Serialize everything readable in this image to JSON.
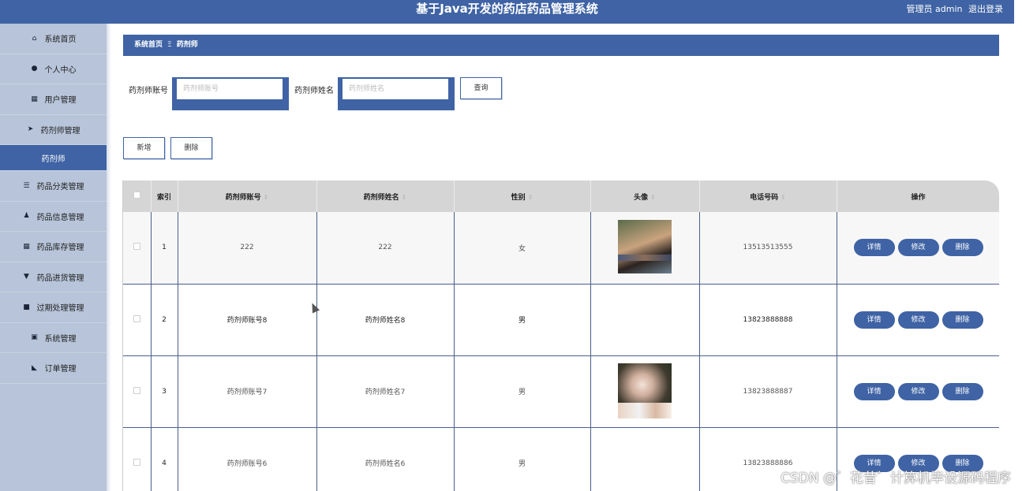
{
  "app": {
    "title": "基于Java开发的药店药品管理系统",
    "user_label": "管理员 admin",
    "logout_label": "退出登录"
  },
  "sidebar": {
    "items": [
      {
        "label": "系统首页",
        "icon": "home-icon"
      },
      {
        "label": "个人中心",
        "icon": "user-icon"
      },
      {
        "label": "用户管理",
        "icon": "grid-icon"
      },
      {
        "label": "药剂师管理",
        "icon": "send-icon"
      },
      {
        "label": "药剂师",
        "icon": "",
        "active": true
      },
      {
        "label": "药品分类管理",
        "icon": "sliders-icon"
      },
      {
        "label": "药品信息管理",
        "icon": "person-icon"
      },
      {
        "label": "药品库存管理",
        "icon": "grid-icon"
      },
      {
        "label": "药品进货管理",
        "icon": "cup-icon"
      },
      {
        "label": "过期处理管理",
        "icon": "box-icon"
      },
      {
        "label": "系统管理",
        "icon": "clipboard-icon"
      },
      {
        "label": "订单管理",
        "icon": "thumb-icon"
      }
    ]
  },
  "breadcrumb": {
    "home": "系统首页",
    "separator": "Ξ",
    "current": "药剂师"
  },
  "search": {
    "account_label": "药剂师账号",
    "account_placeholder": "药剂师账号",
    "account_value": "",
    "name_label": "药剂师姓名",
    "name_placeholder": "药剂师姓名",
    "name_value": "",
    "query_button": "查询"
  },
  "toolbar": {
    "add_button": "新增",
    "delete_button": "删除"
  },
  "table": {
    "columns": [
      "索引",
      "药剂师账号",
      "药剂师姓名",
      "性别",
      "头像",
      "电话号码",
      "操作"
    ],
    "rows": [
      {
        "index": "1",
        "account": "222",
        "name": "222",
        "gender": "女",
        "phone": "13513513555"
      },
      {
        "index": "2",
        "account": "药剂师账号8",
        "name": "药剂师姓名8",
        "gender": "男",
        "phone": "13823888888"
      },
      {
        "index": "3",
        "account": "药剂师账号7",
        "name": "药剂师姓名7",
        "gender": "男",
        "phone": "13823888887"
      },
      {
        "index": "4",
        "account": "药剂师账号6",
        "name": "药剂师姓名6",
        "gender": "男",
        "phone": "13823888886"
      }
    ],
    "actions": {
      "detail": "详情",
      "edit": "修改",
      "delete": "删除"
    }
  },
  "watermark": "CSDN @゛花昔゛计算机毕设源码程序",
  "colors": {
    "primary": "#3f63a4",
    "sidebar": "#b7c4d9",
    "header_row": "#d5d5d5"
  }
}
